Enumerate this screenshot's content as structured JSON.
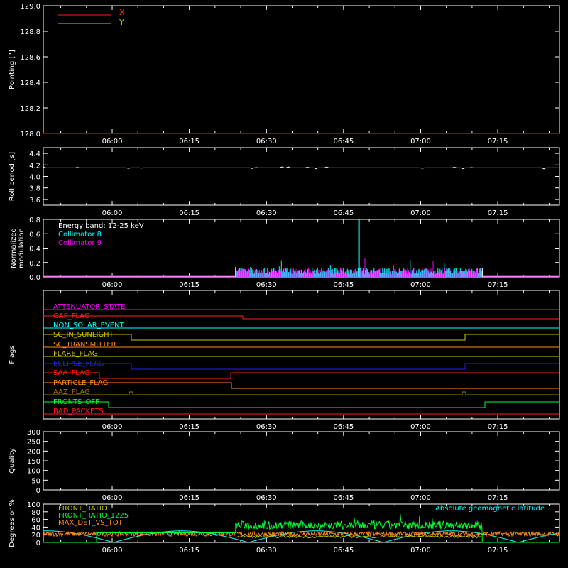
{
  "x_ticks": [
    "06:00",
    "06:15",
    "06:30",
    "06:45",
    "07:00",
    "07:15"
  ],
  "colors": {
    "bg": "#000000",
    "axis": "#ffffff",
    "red": "#ff2020",
    "yellow": "#c8c800",
    "cyan": "#00ffff",
    "magenta": "#ff00ff",
    "orange": "#ff8c1a",
    "green": "#00ff33",
    "blue": "#2020ff",
    "olive": "#a08000"
  },
  "chart_data": [
    {
      "type": "line",
      "ylabel": "Pointing [\"]",
      "ylim": [
        128.0,
        129.0
      ],
      "yticks": [
        "128.0",
        "128.2",
        "128.4",
        "128.6",
        "128.8",
        "129.0"
      ],
      "legend": [
        "X",
        "Y"
      ],
      "legend_placement": "top-left",
      "series": [
        {
          "name": "X",
          "values": [
            128.0,
            128.0
          ]
        },
        {
          "name": "Y",
          "values": [
            128.0,
            128.0
          ]
        }
      ]
    },
    {
      "type": "line",
      "ylabel": "Roll period [s]",
      "ylim": [
        3.5,
        4.5
      ],
      "yticks": [
        "3.6",
        "3.8",
        "4.0",
        "4.2",
        "4.4"
      ],
      "series": [
        {
          "name": "",
          "values": [
            4.15,
            4.15
          ]
        }
      ]
    },
    {
      "type": "bar",
      "ylabel": "Normalized modulation",
      "ylim": [
        0,
        0.8
      ],
      "yticks": [
        "0.0",
        "0.2",
        "0.4",
        "0.6",
        "0.8"
      ],
      "annotation": "Energy band: 12-25 keV",
      "legend": [
        "Collimator 8",
        "Collimator 9"
      ],
      "time_range": [
        "06:24",
        "07:12"
      ],
      "typical_value": 0.1,
      "peak": {
        "time": "06:48",
        "value": 0.8
      }
    },
    {
      "type": "line",
      "ylabel": "Flags",
      "flags": [
        {
          "label": "ATTENUATOR_STATE"
        },
        {
          "label": "GAP_FLAG"
        },
        {
          "label": "NON_SOLAR_EVENT"
        },
        {
          "label": "SC_IN_SUNLIGHT"
        },
        {
          "label": "SC_TRANSMITTER"
        },
        {
          "label": "FLARE_FLAG"
        },
        {
          "label": "ECLIPSE_FLAG"
        },
        {
          "label": "SAA_FLAG"
        },
        {
          "label": "PARTICLE_FLAG"
        },
        {
          "label": "AAZ_FLAG"
        },
        {
          "label": "FRONTS_OFF"
        },
        {
          "label": "BAD_PACKETS"
        }
      ]
    },
    {
      "type": "line",
      "ylabel": "Quality",
      "ylim": [
        0,
        300
      ],
      "yticks": [
        "0",
        "50",
        "100",
        "150",
        "200",
        "250",
        "300"
      ],
      "series": []
    },
    {
      "type": "line",
      "ylabel": "Degrees or %",
      "ylim": [
        0,
        100
      ],
      "yticks": [
        "0",
        "20",
        "40",
        "60",
        "80",
        "100"
      ],
      "legend": [
        "FRONT_RATIO",
        "FRONT_RATIO_1225",
        "MAX_DET_VS_TOT"
      ],
      "right_label": "Absolute geomagnetic latitude",
      "series": [
        {
          "name": "FRONT_RATIO",
          "typical": 15
        },
        {
          "name": "FRONT_RATIO_1225",
          "typical": 45,
          "time_range": [
            "06:24",
            "07:12"
          ]
        },
        {
          "name": "MAX_DET_VS_TOT",
          "typical": 22
        },
        {
          "name": "Absolute geomagnetic latitude",
          "min": 0,
          "max": 30
        }
      ]
    }
  ]
}
